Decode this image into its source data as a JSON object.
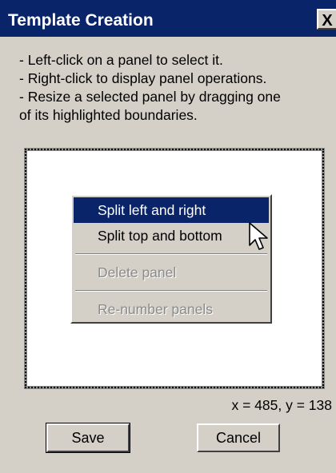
{
  "window": {
    "title": "Template Creation",
    "close_label": "X"
  },
  "instructions": [
    "- Left-click on a panel to select it.",
    "- Right-click to display panel operations.",
    "- Resize a selected panel by dragging one",
    "of its highlighted boundaries."
  ],
  "context_menu": {
    "items": [
      {
        "label": "Split left and right",
        "enabled": true,
        "highlighted": true
      },
      {
        "label": "Split top and bottom",
        "enabled": true,
        "highlighted": false
      },
      {
        "label": "Delete panel",
        "enabled": false,
        "highlighted": false
      },
      {
        "label": "Re-number panels",
        "enabled": false,
        "highlighted": false
      }
    ]
  },
  "coordinates": "x = 485, y = 138",
  "buttons": {
    "save": "Save",
    "cancel": "Cancel"
  },
  "colors": {
    "titlebar": "#0a246a",
    "menu_highlight": "#0a246a",
    "dialog_face": "#d4d0c8",
    "disabled_text": "#8a8a8a"
  },
  "icons": {
    "close": "close-icon",
    "cursor": "arrow-cursor-icon"
  }
}
